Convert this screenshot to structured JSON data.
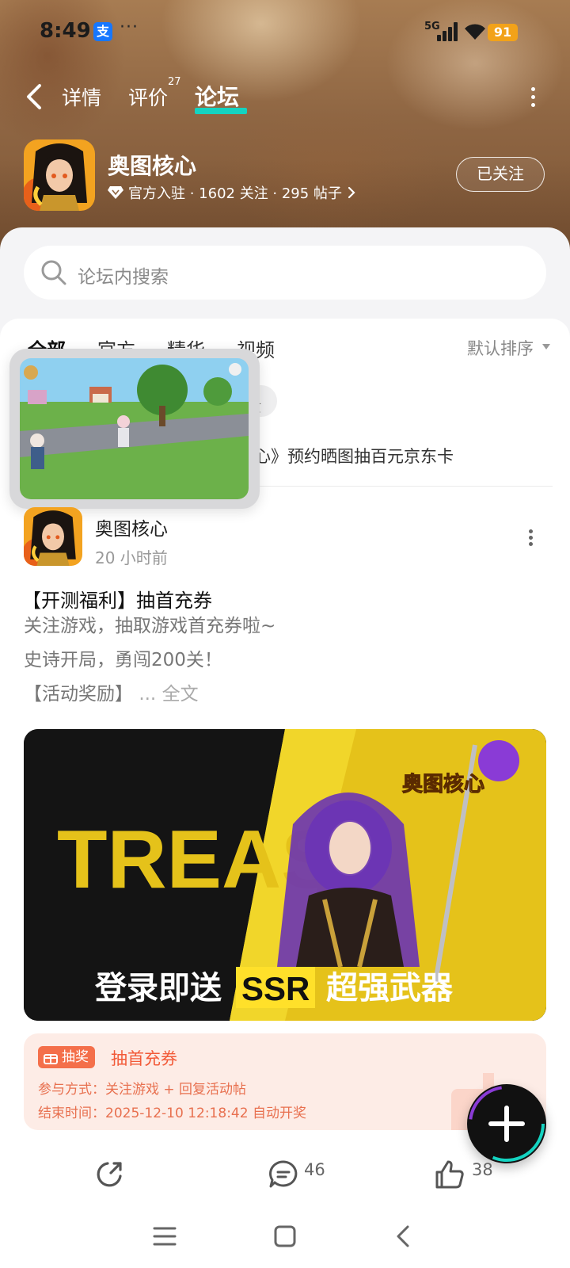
{
  "status_bar": {
    "time": "8:49",
    "alipay_label": "支",
    "dots": "···",
    "network": "5G",
    "battery": "91"
  },
  "nav": {
    "tabs": [
      {
        "label": "详情"
      },
      {
        "label": "评价",
        "badge": "27"
      },
      {
        "label": "论坛"
      }
    ]
  },
  "game": {
    "name": "奥图核心",
    "meta": "官方入驻 · 1602 关注 · 295 帖子",
    "follow_label": "已关注"
  },
  "search": {
    "placeholder": "论坛内搜索"
  },
  "filter": {
    "tabs": [
      "全部",
      "官方",
      "精华",
      "视频"
    ],
    "sort_label": "默认排序"
  },
  "pinned": {
    "pill_text": "馈",
    "notice_text": "核心》预约晒图抽百元京东卡"
  },
  "post": {
    "author": "奥图核心",
    "time": "20 小时前",
    "title": "【开测福利】抽首充券",
    "lines": [
      "关注游戏，抽取游戏首充券啦~",
      "史诗开局，勇闯200关！",
      "【活动奖励】"
    ],
    "ellipsis": "...",
    "full_text_link": "全文",
    "banner": {
      "big_text": "TREASURE",
      "logo": "奥图核心",
      "caption_left": "登录即送",
      "caption_badge": "SSR",
      "caption_right": "超强武器"
    }
  },
  "lottery": {
    "tag": "抽奖",
    "title": "抽首充券",
    "join_method": "参与方式：关注游戏 + 回复活动帖",
    "end_time": "结束时间：2025-12-10 12:18:42 自动开奖"
  },
  "actions": {
    "comments": "46",
    "likes": "38"
  },
  "colors": {
    "accent": "#14d3c1",
    "lottery_orange": "#f46f4a"
  }
}
